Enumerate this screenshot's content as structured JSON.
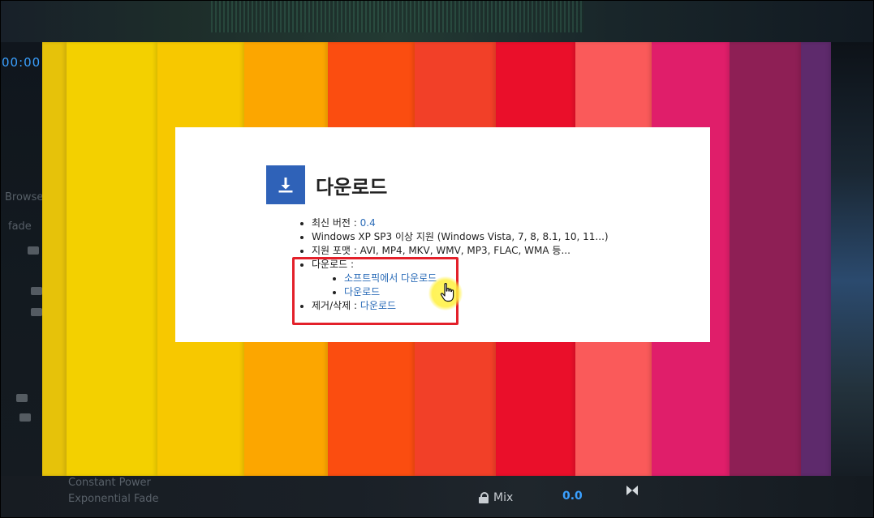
{
  "backdrop": {
    "timecode": "00:00",
    "browser_label": "Browser",
    "fade_label": "fade",
    "constant_power_label": "Constant Power",
    "exponential_fade_label": "Exponential Fade",
    "mix_label": "Mix",
    "mix_value": "0.0"
  },
  "stripe_colors": [
    "#e6c20a",
    "#f3d000",
    "#f7c800",
    "#fca600",
    "#fb4d10",
    "#f24028",
    "#ea0f2a",
    "#fa5a5a",
    "#e01e6a",
    "#8e1f55",
    "#5e2a6c"
  ],
  "card": {
    "heading": "다운로드",
    "items": [
      {
        "label": "최신 버전 : ",
        "link": "0.4"
      },
      {
        "label": "Windows XP SP3 이상 지원 (Windows Vista, 7, 8, 8.1, 10, 11...)"
      },
      {
        "label": "지원 포맷 : AVI, MP4, MKV, WMV, MP3, FLAC, WMA 등..."
      },
      {
        "label": "다운로드 :"
      },
      {
        "label": "제거/삭제 : ",
        "link": "다운로드"
      }
    ],
    "sub_items": [
      "소프트픽에서 다운로드",
      "다운로드"
    ]
  },
  "icons": {
    "heading_icon": "download-icon",
    "cursor": "hand-pointer-icon"
  },
  "colors": {
    "accent": "#2f62b8",
    "link": "#2b6cb8",
    "highlight": "#e3202a",
    "cursor_glow": "#fff45a"
  }
}
